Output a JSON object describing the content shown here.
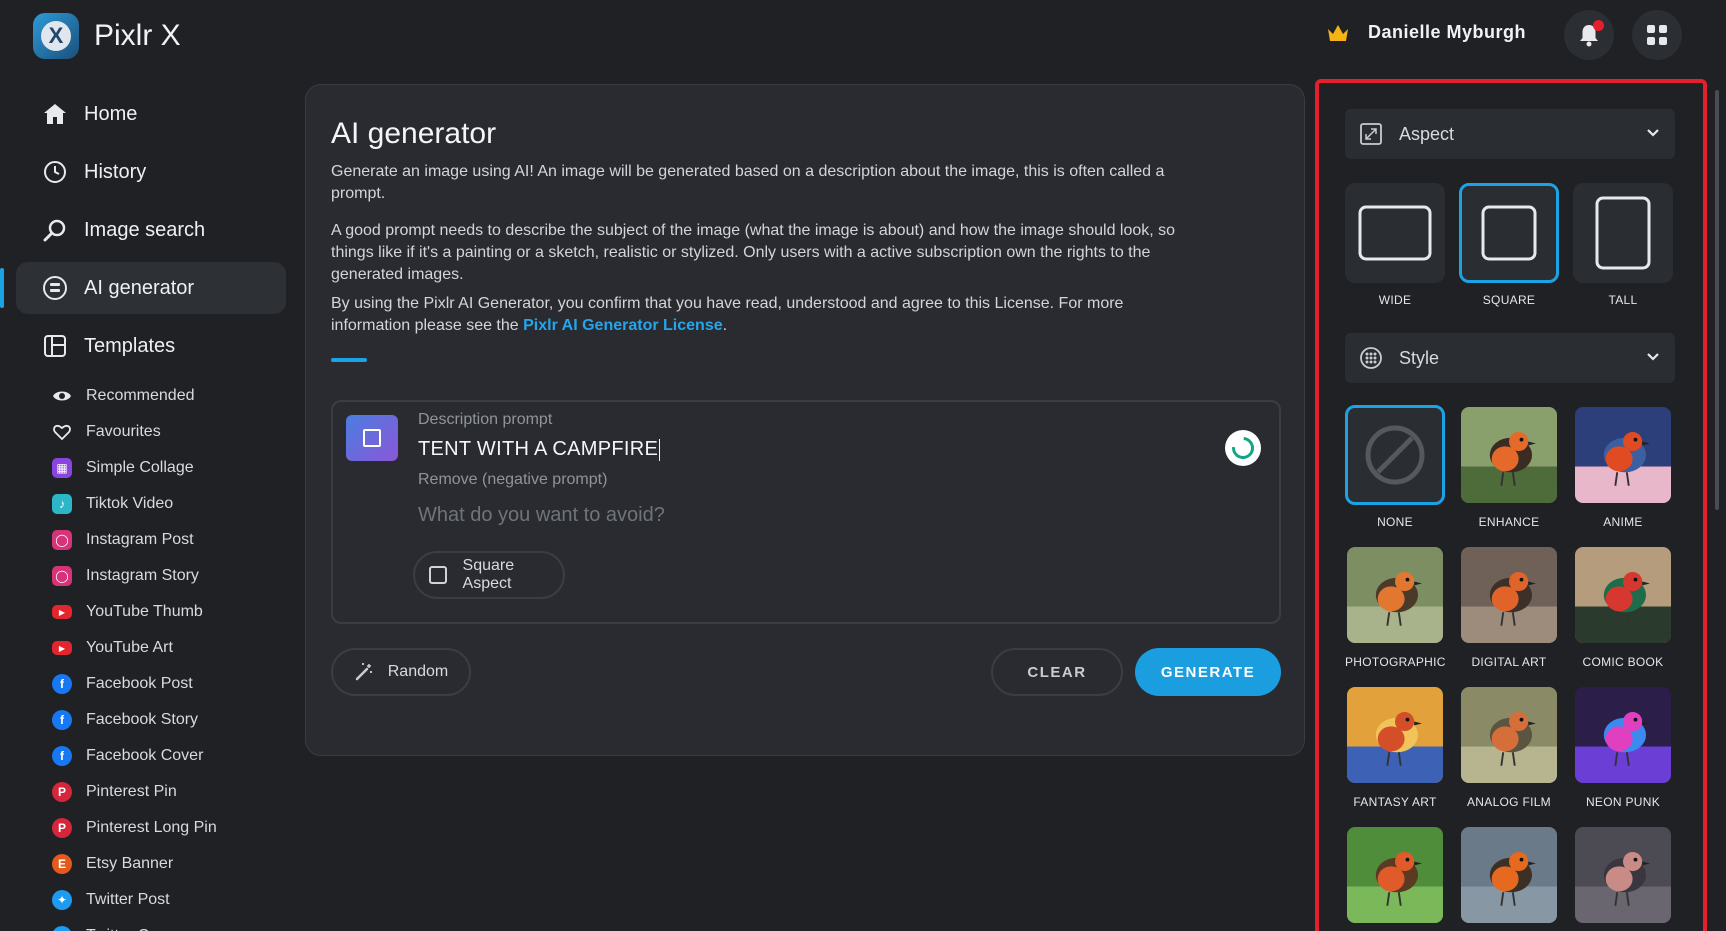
{
  "app": {
    "title": "Pixlr X",
    "logo_letter": "X"
  },
  "user": {
    "name": "Danielle Myburgh"
  },
  "sidebar": {
    "nav": [
      {
        "label": "Home",
        "icon": "home-icon"
      },
      {
        "label": "History",
        "icon": "clock-icon"
      },
      {
        "label": "Image search",
        "icon": "search-icon"
      },
      {
        "label": "AI generator",
        "icon": "ai-icon",
        "active": true
      },
      {
        "label": "Templates",
        "icon": "templates-icon"
      }
    ],
    "templates": [
      {
        "label": "Recommended",
        "icon": "eye-icon",
        "color": ""
      },
      {
        "label": "Favourites",
        "icon": "heart-icon",
        "color": ""
      },
      {
        "label": "Simple Collage",
        "icon": "collage-icon",
        "color": "#8a44e0"
      },
      {
        "label": "Tiktok Video",
        "icon": "tiktok-icon",
        "color": "#2bb7c7"
      },
      {
        "label": "Instagram Post",
        "icon": "instagram-icon",
        "color": "#d6337a"
      },
      {
        "label": "Instagram Story",
        "icon": "instagram-icon",
        "color": "#d6337a"
      },
      {
        "label": "YouTube Thumb",
        "icon": "youtube-icon",
        "color": "#e3262d"
      },
      {
        "label": "YouTube Art",
        "icon": "youtube-icon",
        "color": "#e3262d"
      },
      {
        "label": "Facebook Post",
        "icon": "facebook-icon",
        "color": "#1877f2"
      },
      {
        "label": "Facebook Story",
        "icon": "facebook-icon",
        "color": "#1877f2"
      },
      {
        "label": "Facebook Cover",
        "icon": "facebook-icon",
        "color": "#1877f2"
      },
      {
        "label": "Pinterest Pin",
        "icon": "pinterest-icon",
        "color": "#d6263b"
      },
      {
        "label": "Pinterest Long Pin",
        "icon": "pinterest-icon",
        "color": "#d6263b"
      },
      {
        "label": "Etsy Banner",
        "icon": "etsy-icon",
        "color": "#e45a1c"
      },
      {
        "label": "Twitter Post",
        "icon": "twitter-icon",
        "color": "#1d9bf0"
      },
      {
        "label": "Twitter Cover",
        "icon": "twitter-icon",
        "color": "#1d9bf0"
      }
    ]
  },
  "main": {
    "title": "AI generator",
    "intro": "Generate an image using AI! An image will be generated based on a description about the image, this is often called a prompt.",
    "guidance": "A good prompt needs to describe the subject of the image (what the image is about) and how the image should look, so things like if it's a painting or a sketch, realistic or stylized. Only users with a active subscription own the rights to the generated images.",
    "license_text": "By using the Pixlr AI Generator, you confirm that you have read, understood and agree to this License. For more information please see the",
    "license_link": "Pixlr AI Generator License",
    "license_end": ".",
    "prompt_label": "Description prompt",
    "prompt_value": "TENT WITH A CAMPFIRE",
    "negative_label": "Remove (negative prompt)",
    "negative_placeholder": "What do you want to avoid?",
    "square_aspect_label": "Square Aspect",
    "square_aspect_checked": false,
    "random_label": "Random",
    "clear_label": "CLEAR",
    "generate_label": "GENERATE"
  },
  "panel": {
    "aspect_title": "Aspect",
    "aspects": [
      {
        "label": "WIDE",
        "selected": false
      },
      {
        "label": "SQUARE",
        "selected": true
      },
      {
        "label": "TALL",
        "selected": false
      }
    ],
    "style_title": "Style",
    "styles": [
      {
        "label": "NONE",
        "selected": true
      },
      {
        "label": "ENHANCE"
      },
      {
        "label": "ANIME"
      },
      {
        "label": "PHOTOGRAPHIC"
      },
      {
        "label": "DIGITAL ART"
      },
      {
        "label": "COMIC BOOK"
      },
      {
        "label": "FANTASY ART"
      },
      {
        "label": "ANALOG FILM"
      },
      {
        "label": "NEON PUNK"
      },
      {
        "label": ""
      },
      {
        "label": ""
      },
      {
        "label": ""
      }
    ]
  },
  "colors": {
    "accent": "#1ba3e6",
    "highlight_border": "#e4202f",
    "background": "#1f2125"
  }
}
